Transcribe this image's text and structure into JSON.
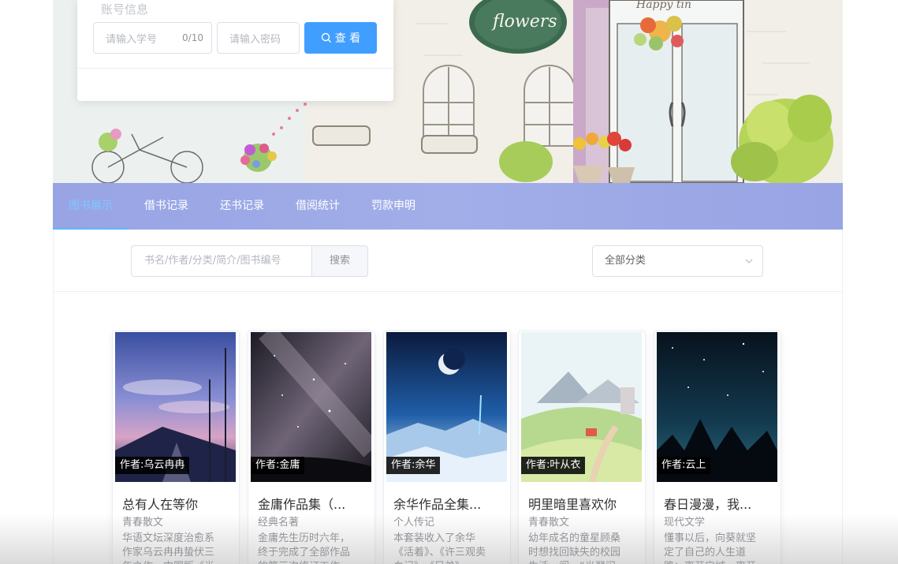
{
  "hero": {
    "sign_text": "flowers",
    "banner_text": "Happy tin"
  },
  "login": {
    "title": "账号信息",
    "student_id_placeholder": "请输入学号",
    "student_id_counter": "0/10",
    "password_placeholder": "请输入密码",
    "view_button": "查 看"
  },
  "nav": {
    "items": [
      {
        "label": "图书展示",
        "active": true
      },
      {
        "label": "借书记录",
        "active": false
      },
      {
        "label": "还书记录",
        "active": false
      },
      {
        "label": "借阅统计",
        "active": false
      },
      {
        "label": "罚款申明",
        "active": false
      }
    ]
  },
  "search": {
    "placeholder": "书名/作者/分类/简介/图书编号",
    "button": "搜索",
    "category_selected": "全部分类"
  },
  "books": [
    {
      "author": "作者:乌云冉冉",
      "title": "总有人在等你",
      "category": "青春散文",
      "desc": "华语文坛深度治愈系作家乌云冉冉蛰伏三年之作。中国版《半"
    },
    {
      "author": "作者:金庸",
      "title": "金庸作品集（...",
      "category": "经典名著",
      "desc": "金庸先生历时六年，终于完成了全部作品的第三次修订工作"
    },
    {
      "author": "作者:余华",
      "title": "余华作品全集...",
      "category": "个人传记",
      "desc": "本套装收入了余华《活着》、《许三观卖血记》、《兄弟》"
    },
    {
      "author": "作者:叶从衣",
      "title": "明里暗里喜欢你",
      "category": "青春散文",
      "desc": "幼年成名的童星顾桑时想找回缺失的校园生活，闯一“光翟闪"
    },
    {
      "author": "作者:云上",
      "title": "春日漫漫，我...",
      "category": "现代文学",
      "desc": "懂事以后，向葵就坚定了自己的人生道路：离开宁城，离开"
    }
  ]
}
